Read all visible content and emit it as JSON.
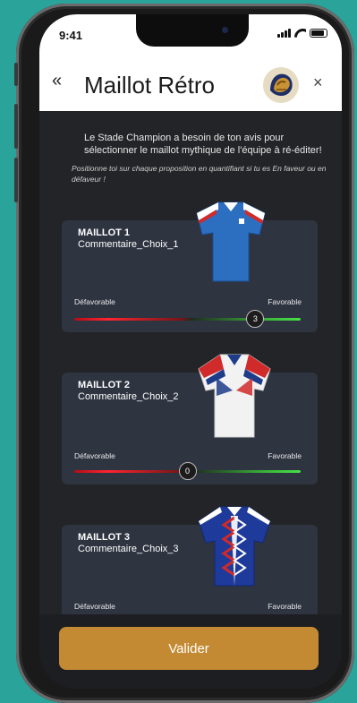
{
  "status_bar": {
    "time": "9:41",
    "battery_level": 0.85
  },
  "header": {
    "back_label": "«",
    "title": "Maillot Rétro",
    "logo_icon": "team-crest-icon",
    "close_label": "×"
  },
  "intro": {
    "text": "Le Stade Champion a besoin de ton avis pour sélectionner le maillot mythique de l'équipe à ré-éditer!",
    "hint": "Positionne toi sur chaque proposition en quantifiant si tu es En faveur ou en défaveur !"
  },
  "cards": [
    {
      "title": "MAILLOT 1",
      "comment": "Commentaire_Choix_1",
      "label_left": "Défavorable",
      "label_right": "Favorable",
      "value": "3",
      "range": [
        -5,
        5
      ],
      "jersey_colors": [
        "#2c6fc1",
        "#ffffff",
        "#d12a2a"
      ]
    },
    {
      "title": "MAILLOT 2",
      "comment": "Commentaire_Choix_2",
      "label_left": "Défavorable",
      "label_right": "Favorable",
      "value": "0",
      "range": [
        -5,
        5
      ],
      "jersey_colors": [
        "#f2f2f2",
        "#1e3c8a",
        "#d12a2a"
      ]
    },
    {
      "title": "MAILLOT 3",
      "comment": "Commentaire_Choix_3",
      "label_left": "Défavorable",
      "label_right": "Favorable",
      "jersey_colors": [
        "#1e3a9a",
        "#ffffff",
        "#d12a2a"
      ]
    }
  ],
  "footer": {
    "validate_label": "Valider"
  },
  "colors": {
    "accent": "#c38a33",
    "card_bg": "#2e3440",
    "screen_bg": "#232427",
    "unfavorable": "#ff2430",
    "favorable": "#48e048",
    "page_bg": "#2aa39a"
  }
}
